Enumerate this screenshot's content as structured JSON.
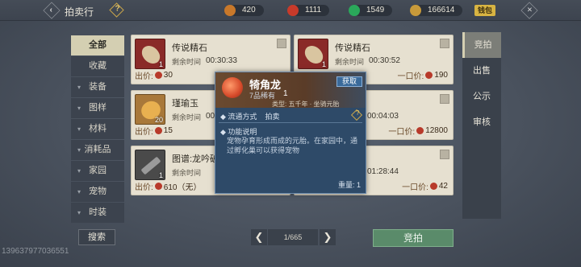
{
  "topbar": {
    "title": "拍卖行",
    "help_icon": "?",
    "back_icon": "‹",
    "close_icon": "×",
    "currencies": [
      {
        "icon": "gold-ingot-icon",
        "value": "420",
        "color": "#c8782a"
      },
      {
        "icon": "red-coin-icon",
        "value": "1111",
        "color": "#c83a2a"
      },
      {
        "icon": "jade-icon",
        "value": "1549",
        "color": "#2aa85a"
      },
      {
        "icon": "copper-coin-icon",
        "value": "166614",
        "color": "#c89a3a"
      }
    ],
    "recharge_label": "钱包"
  },
  "categories": [
    {
      "label": "全部",
      "active": true,
      "arrow": false
    },
    {
      "label": "收藏",
      "active": false,
      "arrow": false
    },
    {
      "label": "装备",
      "active": false,
      "arrow": true
    },
    {
      "label": "图样",
      "active": false,
      "arrow": true
    },
    {
      "label": "材料",
      "active": false,
      "arrow": true
    },
    {
      "label": "消耗品",
      "active": false,
      "arrow": true
    },
    {
      "label": "家园",
      "active": false,
      "arrow": true
    },
    {
      "label": "宠物",
      "active": false,
      "arrow": true
    },
    {
      "label": "时装",
      "active": false,
      "arrow": true
    }
  ],
  "cards": [
    {
      "name": "传说精石",
      "remain_label": "剩余时间",
      "remain": "00:30:33",
      "qty": "1",
      "bid_label": "出价:",
      "bid": "30",
      "buy_label": "",
      "buy": "",
      "thumb": "red"
    },
    {
      "name": "传说精石",
      "remain_label": "剩余时间",
      "remain": "00:30:52",
      "qty": "1",
      "bid_label": "",
      "bid": "",
      "buy_label": "一口价:",
      "buy": "190",
      "thumb": "red"
    },
    {
      "name": "瑾瑜玉",
      "remain_label": "剩余时间",
      "remain": "00:30:33",
      "qty": "20",
      "bid_label": "出价:",
      "bid": "15",
      "buy_label": "",
      "buy": "",
      "thumb": "gold"
    },
    {
      "name": "",
      "remain_label": "",
      "remain": "00:04:03",
      "qty": "",
      "bid_label": "",
      "bid": "",
      "buy_label": "一口价:",
      "buy": "12800",
      "thumb": "none"
    },
    {
      "name": "图谱:龙吟破",
      "remain_label": "剩余时间",
      "remain": "",
      "qty": "1",
      "bid_label": "出价:",
      "bid": "610（无）",
      "buy_label": "",
      "buy": "",
      "thumb": "grey"
    },
    {
      "name": "",
      "remain_label": "",
      "remain": "01:28:44",
      "qty": "",
      "bid_label": "",
      "bid": "",
      "buy_label": "一口价:",
      "buy": "42",
      "thumb": "none"
    }
  ],
  "right_tabs": [
    {
      "label": "竞拍",
      "active": true
    },
    {
      "label": "出售",
      "active": false
    },
    {
      "label": "公示",
      "active": false
    },
    {
      "label": "审核",
      "active": false
    }
  ],
  "bottom": {
    "search_label": "搜索",
    "page": "1/665",
    "prev_icon": "❮",
    "next_icon": "❯",
    "bid_button": "竞拍",
    "uid": "1396379770365​51"
  },
  "popup": {
    "name": "犄角龙",
    "rarity": "7品稀有",
    "qty": "1",
    "get_label": "获取",
    "type_line": "类型: 五千年 · 坐骑元胎",
    "flow_label": "流通方式",
    "flow_value": "拍卖",
    "help": "?",
    "func_label": "功能说明",
    "desc": "宠物孕育形成而成的元胎。在家园中，通过孵化巢可以获得宠物",
    "weight": "重量: 1"
  }
}
